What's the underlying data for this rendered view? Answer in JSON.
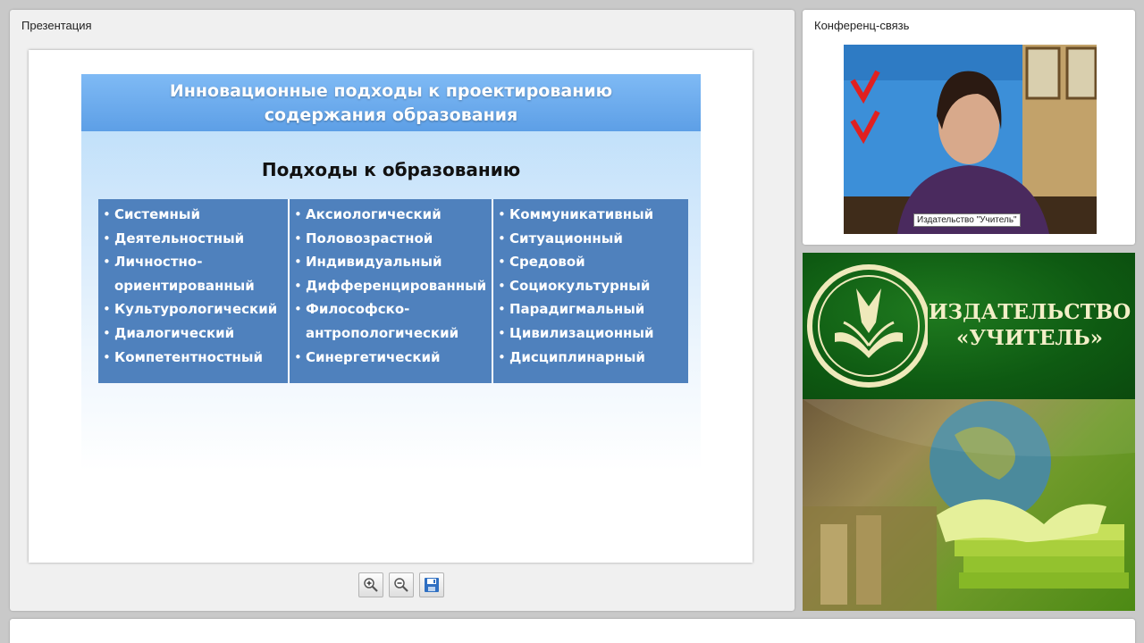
{
  "presentation": {
    "title": "Презентация",
    "slide": {
      "heading": "Инновационные подходы к проектированию\nсодержания образования",
      "subheading": "Подходы к образованию",
      "columns": [
        [
          "Системный",
          "Деятельностный",
          "Личностно-\nориентированный",
          "Культурологический",
          "Диалогический",
          "Компетентностный"
        ],
        [
          "Аксиологический",
          "Половозрастной",
          "Индивидуальный",
          "Дифференцированный",
          "Философско-\nантропологический",
          "Синергетический"
        ],
        [
          "Коммуникативный",
          "Ситуационный",
          "Средовой",
          "Социокультурный",
          "Парадигмальный",
          "Цивилизационный",
          "Дисциплинарный"
        ]
      ]
    },
    "toolbar": {
      "zoom_in_icon": "zoom-in-icon",
      "zoom_out_icon": "zoom-out-icon",
      "save_icon": "floppy-disk-icon"
    }
  },
  "conference": {
    "title": "Конференц-связь",
    "participant_name": "Издательство \"Учитель\""
  },
  "publisher": {
    "name": "ИЗДАТЕЛЬСТВО\n«УЧИТЕЛЬ»"
  },
  "colors": {
    "slide_header": "#6aa9ee",
    "table_bg": "#4f81bd",
    "banner_green": "#0e5a12",
    "banner_text": "#f3efc8"
  }
}
